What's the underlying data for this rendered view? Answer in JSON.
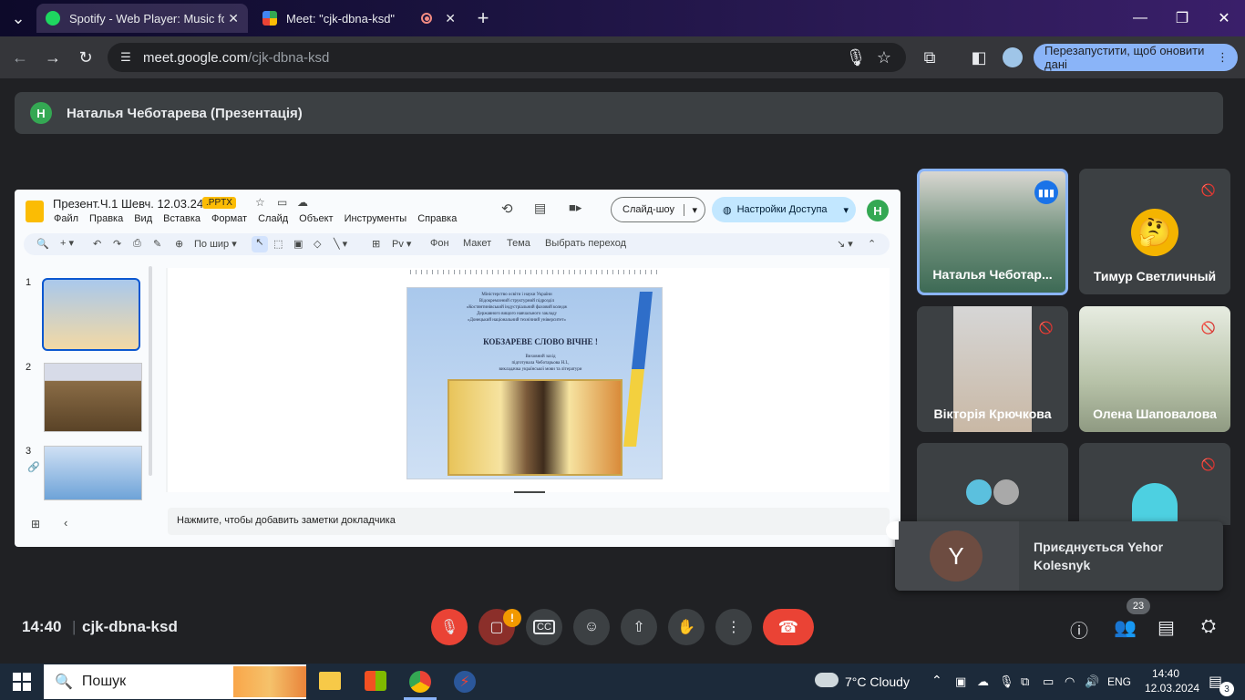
{
  "browser": {
    "tabs": [
      {
        "title": "Spotify - Web Player: Music for",
        "active": false
      },
      {
        "title": "Meet: \"cjk-dbna-ksd\"",
        "active": true
      }
    ],
    "url_host": "meet.google.com",
    "url_path": "/cjk-dbna-ksd",
    "restart_label": "Перезапустити, щоб оновити дані"
  },
  "meet": {
    "presenter_initial": "Н",
    "presenter_title": "Наталья Чеботарева (Презентація)",
    "clock": "14:40",
    "meeting_code": "cjk-dbna-ksd",
    "participants_count": "23",
    "join_notice": {
      "initial": "Y",
      "text": "Приєднується Yehor Kolesnyk"
    },
    "tiles": [
      {
        "name": "Наталья Чеботар...",
        "speaking": true
      },
      {
        "name": "Тимур Светличный",
        "muted": true
      },
      {
        "name": "Вікторія Крючкова",
        "muted": true
      },
      {
        "name": "Олена Шаповалова",
        "muted": true
      },
      {
        "name": "",
        "muted": false
      },
      {
        "name": "",
        "muted": true
      }
    ]
  },
  "slides_app": {
    "doc_title": "Презент.Ч.1 Шевч. 12.03.24",
    "badge": ".PPTX",
    "menu": [
      "Файл",
      "Правка",
      "Вид",
      "Вставка",
      "Формат",
      "Слайд",
      "Объект",
      "Инструменты",
      "Справка"
    ],
    "slideshow_label": "Слайд-шоу",
    "share_label": "Настройки Доступа",
    "user_initial": "Н",
    "zoom_label": "По шир",
    "toolbar_text": [
      "Фон",
      "Макет",
      "Тема",
      "Выбрать переход"
    ],
    "thumb_numbers": [
      "1",
      "2",
      "3"
    ],
    "notes_placeholder": "Нажмите, чтобы добавить заметки докладчика",
    "slide_heading": "КОБЗАРЕВЕ СЛОВО ВІЧНЕ !",
    "slide_header_lines": [
      "Міністерство освіти і науки України",
      "Відокремлений структурний підрозділ",
      "«Костянтинівський індустріальний фаховий коледж",
      "Державного вищого навчального закладу",
      "«Донецький національний технічний університет»"
    ],
    "slide_sub_lines": [
      "Виховний захід",
      "підготувала Чеботарьова Н.І.,",
      "викладачка української мови та літератури"
    ]
  },
  "taskbar": {
    "search_label": "Пошук",
    "weather": "7°C  Cloudy",
    "lang": "ENG",
    "time": "14:40",
    "date": "12.03.2024",
    "notif_count": "3"
  },
  "colors": {
    "accent": "#8ab4f8",
    "end_call": "#ea4335",
    "mic_off": "#ea4335"
  }
}
